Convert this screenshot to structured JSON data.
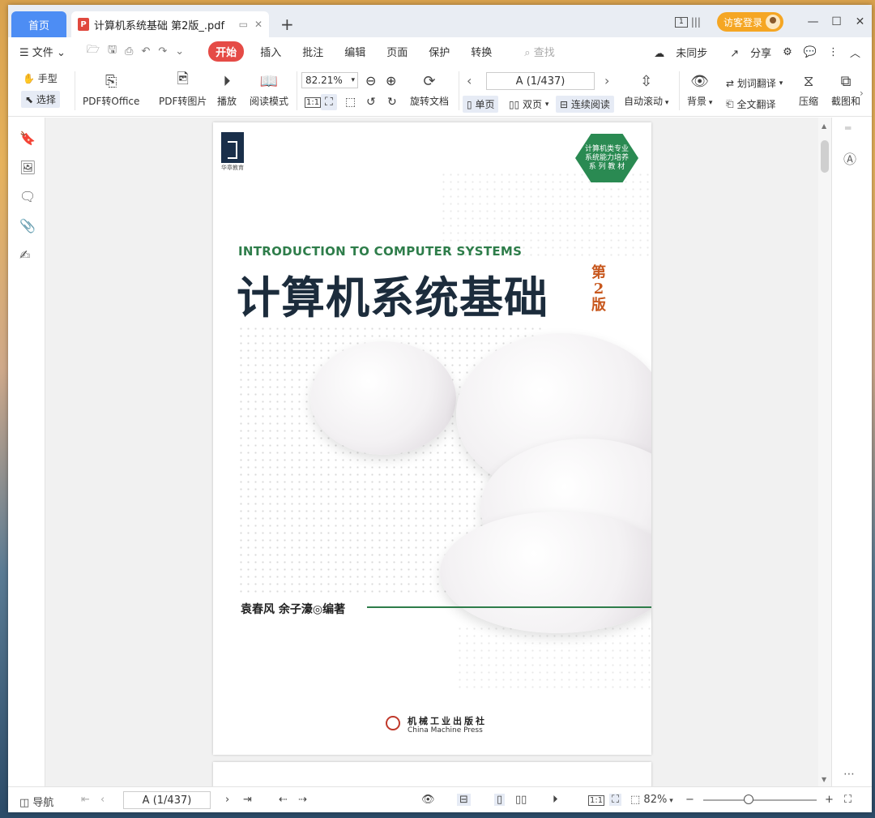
{
  "titlebar": {
    "home_tab": "首页",
    "doc_tab": "计算机系统基础 第2版_.pdf",
    "page_indicator": "1",
    "login_button": "访客登录",
    "new_tab": "+",
    "minimize": "—",
    "maximize": "☐",
    "close": "✕"
  },
  "menubar": {
    "file": "文件",
    "items": [
      "开始",
      "插入",
      "批注",
      "编辑",
      "页面",
      "保护",
      "转换"
    ],
    "search_placeholder": "查找",
    "sync": "未同步",
    "share": "分享"
  },
  "ribbon": {
    "hand": "手型",
    "select": "选择",
    "pdf_to_office": "PDF转Office",
    "pdf_to_image": "PDF转图片",
    "play": "播放",
    "read_mode": "阅读模式",
    "zoom": "82.21%",
    "rotate_doc": "旋转文档",
    "page_nav": "A (1/437)",
    "single_page": "单页",
    "double_page": "双页",
    "continuous": "连续阅读",
    "auto_scroll": "自动滚动",
    "background": "背景",
    "word_translate": "划词翻译",
    "full_translate": "全文翻译",
    "compress": "压缩",
    "screenshot": "截图和"
  },
  "document": {
    "publisher_logo_text": "华章教育",
    "badge": [
      "计算机类专业",
      "系统能力培养",
      "系 列 教 材"
    ],
    "english_title": "INTRODUCTION TO COMPUTER SYSTEMS",
    "chinese_title": "计算机系统基础",
    "edition": [
      "第",
      "2",
      "版"
    ],
    "authors": "袁春风  余子濠◎编著",
    "publisher_cn": "机械工业出版社",
    "publisher_en": "China Machine Press"
  },
  "statusbar": {
    "nav": "导航",
    "page": "A (1/437)",
    "zoom": "82%",
    "minus": "−",
    "plus": "+"
  }
}
